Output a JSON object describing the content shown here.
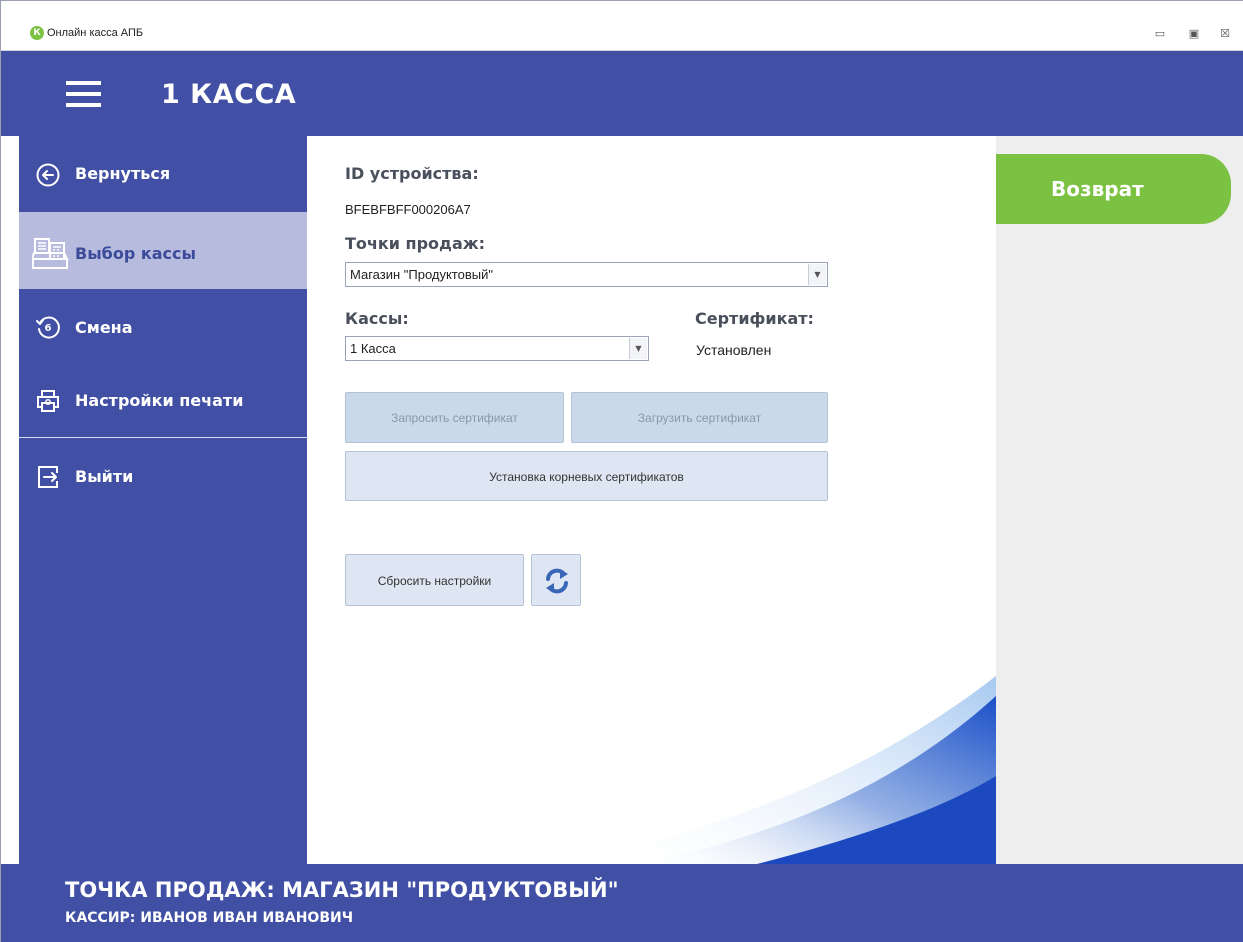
{
  "window": {
    "title": "Онлайн касса АПБ",
    "logo_letter": "К",
    "controls": {
      "minimize": "▭",
      "maximize": "▣",
      "close": "☒"
    }
  },
  "header": {
    "title": "1 КАССА",
    "menu_icon": "hamburger-menu-icon"
  },
  "sidebar": {
    "items": [
      {
        "label": "Вернуться",
        "icon": "arrow-left-circle-icon",
        "active": false
      },
      {
        "label": "Выбор кассы",
        "icon": "cash-register-icon",
        "active": true
      },
      {
        "label": "Смена",
        "icon": "shift-clock-icon",
        "active": false
      },
      {
        "label": "Настройки печати",
        "icon": "printer-icon",
        "active": false
      },
      {
        "label": "Выйти",
        "icon": "logout-icon",
        "active": false
      }
    ],
    "shift_number": "6"
  },
  "main": {
    "device_id_label": "ID устройства:",
    "device_id_value": "BFEBFBFF000206A7",
    "points_label": "Точки продаж:",
    "points_selected": "Магазин \"Продуктовый\"",
    "kassy_label": "Кассы:",
    "kassy_selected": "1 Касса",
    "cert_label": "Сертификат:",
    "cert_value": "Установлен",
    "buttons": {
      "request_cert": "Запросить сертификат",
      "load_cert": "Загрузить сертификат",
      "install_root": "Установка корневых сертификатов",
      "reset_settings": "Сбросить настройки",
      "refresh_icon": "refresh-icon"
    }
  },
  "right": {
    "return_button": "Возврат"
  },
  "footer": {
    "sales_point": "ТОЧКА ПРОДАЖ:  МАГАЗИН \"ПРОДУКТОВЫЙ\"",
    "cashier": "КАССИР: ИВАНОВ ИВАН ИВАНОВИЧ"
  },
  "colors": {
    "brand_blue": "#4150a4",
    "active_item": "#b7bcdf",
    "accent_green": "#7cc242",
    "button_bg": "#d9e3f0"
  }
}
